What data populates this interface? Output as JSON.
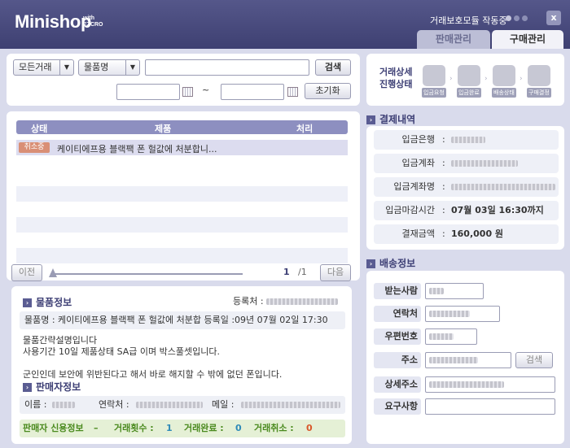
{
  "app": {
    "title": "Minishop",
    "title_sub": "with EZCRO",
    "status": "거래보호모듈 작동중",
    "close": "x"
  },
  "tabs": {
    "sell": "판매관리",
    "buy": "구매관리"
  },
  "search": {
    "filter1": "모든거래",
    "filter2": "물품명",
    "search_btn": "검색",
    "range_sep": "~",
    "reset_btn": "초기화"
  },
  "grid": {
    "headers": [
      "상태",
      "제품",
      "처리"
    ],
    "rows": [
      {
        "status": "취소중",
        "product": "케이티에프용 블랙팩 폰 헐값에 처분합니..."
      }
    ]
  },
  "pager": {
    "prev": "이전",
    "next": "다음",
    "current": "1",
    "total": "/1"
  },
  "item": {
    "section_title": "물품정보",
    "seller_label": "등록처 :",
    "name_line": "물품명 : 케이티에프용 블랙팩 폰 헐값에 처분합  등록일 :09년 07월 02일 17:30",
    "desc": [
      "물품간략설명입니다",
      "사용기간 10일 제품상태 SA급 이며 박스풀셋입니다.",
      "",
      "군인인데 보안에 위반된다고 해서 바로 해지할 수 밖에 없던 폰입니다."
    ]
  },
  "seller": {
    "section_title": "판매자정보",
    "name_label": "이름 :",
    "contact_label": "연락처 :",
    "email_label": "메일 :",
    "credit_title": "판매자 신용정보",
    "sep": "–",
    "count_label": "거래횟수 :",
    "count": "1",
    "done_label": "거래완료 :",
    "done": "0",
    "cancel_label": "거래취소 :",
    "cancel": "0"
  },
  "trade_status": {
    "title_line1": "거래상세",
    "title_line2": "진행상태",
    "steps": [
      "입금요청",
      "입금완료",
      "배송상태",
      "구매결정"
    ]
  },
  "payment": {
    "section_title": "결제내역",
    "rows": [
      {
        "label": "입금은행",
        "value": ""
      },
      {
        "label": "입금계좌",
        "value": ""
      },
      {
        "label": "입금계좌명",
        "value": ""
      },
      {
        "label": "입금마감시간",
        "value": "07월 03일 16:30까지"
      },
      {
        "label": "결재금액",
        "value": "160,000 원"
      }
    ]
  },
  "shipping": {
    "section_title": "배송정보",
    "fields": [
      {
        "label": "받는사람"
      },
      {
        "label": "연락처"
      },
      {
        "label": "우편번호"
      },
      {
        "label": "주소"
      },
      {
        "label": "상세주소"
      },
      {
        "label": "요구사항"
      }
    ],
    "search_btn": "검색"
  }
}
